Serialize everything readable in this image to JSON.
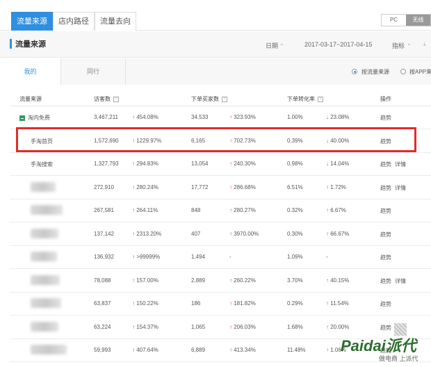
{
  "top_tabs": [
    {
      "label": "流量来源",
      "active": true
    },
    {
      "label": "店内路径",
      "active": false
    },
    {
      "label": "流量去向",
      "active": false
    }
  ],
  "device_toggle": {
    "pc": "PC",
    "wireless": "无线",
    "selected": "无线"
  },
  "section": {
    "title": "流量来源",
    "date_label": "日期",
    "date_range": "2017-03-17~2017-04-15",
    "metric_label": "指标"
  },
  "subtabs": [
    {
      "label": "我的",
      "active": true
    },
    {
      "label": "同行",
      "active": false
    }
  ],
  "radios": [
    {
      "label": "按流量来源",
      "selected": true
    },
    {
      "label": "按APP来源",
      "selected": false
    }
  ],
  "columns": {
    "source": "流量来源",
    "visitors": "访客数",
    "buyers": "下单买家数",
    "conversion": "下单转化率",
    "actions": "操作",
    "help": "?"
  },
  "rows": [
    {
      "source": "淘内免费",
      "expander": true,
      "visitors": "3,467,211",
      "visitors_chg": "454.08%",
      "visitors_dir": "up",
      "buyers": "34,533",
      "buyers_chg": "323.93%",
      "buyers_dir": "up",
      "conv": "1.00%",
      "conv_chg": "23.08%",
      "conv_dir": "down",
      "actions": [
        "趋势"
      ]
    },
    {
      "source": "手淘首页",
      "visitors": "1,572,690",
      "visitors_chg": "1229.97%",
      "visitors_dir": "up",
      "buyers": "6,165",
      "buyers_chg": "702.73%",
      "buyers_dir": "up",
      "conv": "0.39%",
      "conv_chg": "40.00%",
      "conv_dir": "down",
      "actions": [
        "趋势"
      ]
    },
    {
      "source": "手淘搜索",
      "visitors": "1,327,793",
      "visitors_chg": "294.83%",
      "visitors_dir": "up",
      "buyers": "13,054",
      "buyers_chg": "240.30%",
      "buyers_dir": "up",
      "conv": "0.98%",
      "conv_chg": "14.04%",
      "conv_dir": "down",
      "actions": [
        "趋势",
        "详情"
      ]
    },
    {
      "source": "",
      "visitors": "272,910",
      "visitors_chg": "280.24%",
      "visitors_dir": "up",
      "buyers": "17,772",
      "buyers_chg": "286.68%",
      "buyers_dir": "up",
      "conv": "6.51%",
      "conv_chg": "1.72%",
      "conv_dir": "up",
      "actions": [
        "趋势",
        "详情"
      ]
    },
    {
      "source": "",
      "visitors": "267,581",
      "visitors_chg": "264.11%",
      "visitors_dir": "up",
      "buyers": "848",
      "buyers_chg": "280.27%",
      "buyers_dir": "up",
      "conv": "0.32%",
      "conv_chg": "6.67%",
      "conv_dir": "up",
      "actions": [
        "趋势"
      ]
    },
    {
      "source": "",
      "visitors": "137,142",
      "visitors_chg": "2313.20%",
      "visitors_dir": "up",
      "buyers": "407",
      "buyers_chg": "3970.00%",
      "buyers_dir": "up",
      "conv": "0.30%",
      "conv_chg": "66.67%",
      "conv_dir": "up",
      "actions": [
        "趋势"
      ]
    },
    {
      "source": "",
      "visitors": "136,932",
      "visitors_chg": ">99999%",
      "visitors_dir": "up",
      "buyers": "1,494",
      "buyers_chg": "-",
      "buyers_dir": "",
      "conv": "1.09%",
      "conv_chg": "-",
      "conv_dir": "",
      "actions": [
        "趋势"
      ]
    },
    {
      "source": "",
      "visitors": "78,088",
      "visitors_chg": "157.00%",
      "visitors_dir": "up",
      "buyers": "2,889",
      "buyers_chg": "260.22%",
      "buyers_dir": "up",
      "conv": "3.70%",
      "conv_chg": "40.15%",
      "conv_dir": "up",
      "actions": [
        "趋势",
        "详情"
      ]
    },
    {
      "source": "",
      "visitors": "63,837",
      "visitors_chg": "150.22%",
      "visitors_dir": "up",
      "buyers": "186",
      "buyers_chg": "181.82%",
      "buyers_dir": "up",
      "conv": "0.29%",
      "conv_chg": "11.54%",
      "conv_dir": "up",
      "actions": [
        "趋势"
      ]
    },
    {
      "source": "",
      "visitors": "63,224",
      "visitors_chg": "154.37%",
      "visitors_dir": "up",
      "buyers": "1,065",
      "buyers_chg": "206.03%",
      "buyers_dir": "up",
      "conv": "1.68%",
      "conv_chg": "20.00%",
      "conv_dir": "up",
      "actions": [
        "趋势"
      ]
    },
    {
      "source": "",
      "visitors": "59,993",
      "visitors_chg": "407.64%",
      "visitors_dir": "up",
      "buyers": "6,889",
      "buyers_chg": "413.34%",
      "buyers_dir": "up",
      "conv": "11.48%",
      "conv_chg": "1.06%",
      "conv_dir": "up",
      "actions": [
        "趋势"
      ]
    }
  ],
  "watermark": {
    "brand": "Paidai派代",
    "tagline": "做电商 上派代"
  }
}
